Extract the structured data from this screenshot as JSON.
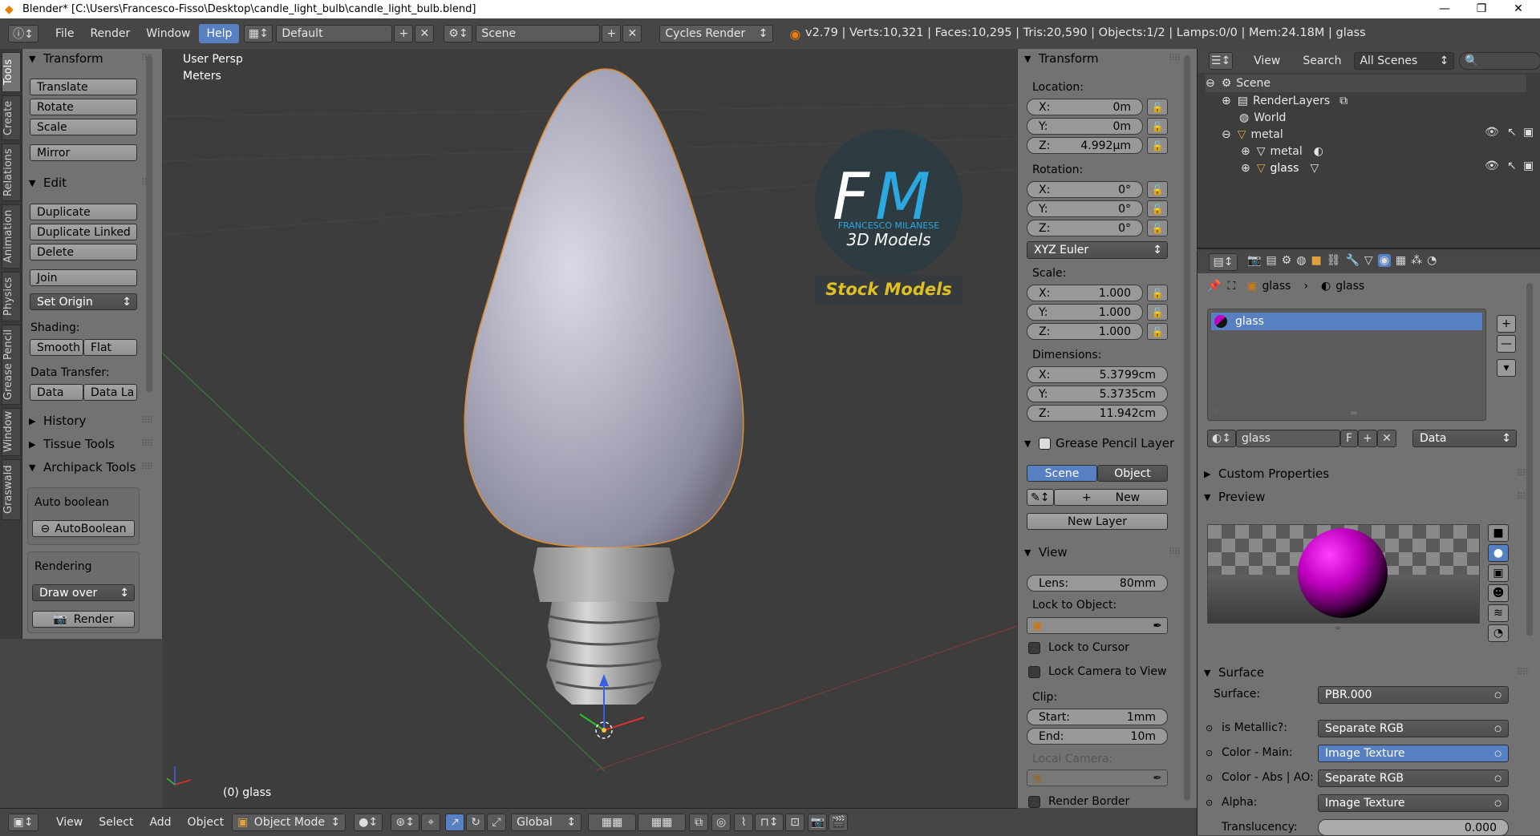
{
  "window": {
    "title": "Blender* [C:\\Users\\Francesco-Fisso\\Desktop\\candle_light_bulb\\candle_light_bulb.blend]"
  },
  "menu": {
    "items": [
      "File",
      "Render",
      "Window",
      "Help"
    ],
    "layout": "Default",
    "scene": "Scene",
    "engine": "Cycles Render"
  },
  "stats": "v2.79 | Verts:10,321 | Faces:10,295 | Tris:20,590 | Objects:1/2 | Lamps:0/0 | Mem:24.18M | glass",
  "tabs": [
    "Tools",
    "Create",
    "Relations",
    "Animation",
    "Physics",
    "Grease Pencil",
    "Window",
    "Graswald"
  ],
  "toolshelf": {
    "transform_title": "Transform",
    "translate": "Translate",
    "rotate": "Rotate",
    "scale": "Scale",
    "mirror": "Mirror",
    "edit_title": "Edit",
    "duplicate": "Duplicate",
    "duplicate_linked": "Duplicate Linked",
    "delete": "Delete",
    "join": "Join",
    "set_origin": "Set Origin",
    "shading_label": "Shading:",
    "smooth": "Smooth",
    "flat": "Flat",
    "data_transfer_label": "Data Transfer:",
    "data": "Data",
    "data_la": "Data La",
    "history": "History",
    "tissue": "Tissue Tools",
    "archipack": "Archipack Tools",
    "auto_boolean_label": "Auto boolean",
    "auto_boolean_btn": "AutoBoolean",
    "rendering_label": "Rendering",
    "draw_over": "Draw over",
    "render": "Render"
  },
  "viewport": {
    "view_name": "User Persp",
    "units": "Meters",
    "object_label": "(0) glass",
    "logo": {
      "letters_f": "F",
      "letters_m": "M",
      "name": "FRANCESCO MILANESE",
      "sub": "3D Models",
      "stock": "Stock Models"
    }
  },
  "npanel": {
    "transform_title": "Transform",
    "location_label": "Location:",
    "loc_x": "0m",
    "loc_y": "0m",
    "loc_z": "4.992µm",
    "rotation_label": "Rotation:",
    "rot_x": "0°",
    "rot_y": "0°",
    "rot_z": "0°",
    "rot_mode": "XYZ Euler",
    "scale_label": "Scale:",
    "scale_x": "1.000",
    "scale_y": "1.000",
    "scale_z": "1.000",
    "dimensions_label": "Dimensions:",
    "dim_x": "5.3799cm",
    "dim_y": "5.3735cm",
    "dim_z": "11.942cm",
    "grease_title": "Grease Pencil Layer",
    "scene_btn": "Scene",
    "object_btn": "Object",
    "new_btn": "New",
    "new_layer": "New Layer",
    "view_title": "View",
    "lens_label": "Lens:",
    "lens_value": "80mm",
    "lock_object_label": "Lock to Object:",
    "lock_cursor": "Lock to Cursor",
    "lock_camera": "Lock Camera to View",
    "clip_label": "Clip:",
    "clip_start_label": "Start:",
    "clip_start": "1mm",
    "clip_end_label": "End:",
    "clip_end": "10m",
    "local_camera": "Local Camera:",
    "render_border": "Render Border"
  },
  "axis_labels": {
    "x": "X:",
    "y": "Y:",
    "z": "Z:"
  },
  "outliner": {
    "view": "View",
    "search": "Search",
    "filter": "All Scenes",
    "rows": [
      {
        "label": "Scene"
      },
      {
        "label": "RenderLayers"
      },
      {
        "label": "World"
      },
      {
        "label": "metal"
      },
      {
        "label": "metal"
      },
      {
        "label": "glass"
      }
    ]
  },
  "properties": {
    "crumb_1": "glass",
    "crumb_2": "glass",
    "slot": "glass",
    "material_name": "glass",
    "f_label": "F",
    "data_dropdown": "Data",
    "custom_props": "Custom Properties",
    "preview": "Preview",
    "surface_title": "Surface",
    "surface_label": "Surface:",
    "surface_value": "PBR.000",
    "metallic_label": "is Metallic?:",
    "metallic_value": "Separate RGB",
    "color_main_label": "Color - Main:",
    "color_main_value": "Image Texture",
    "color_abs_label": "Color - Abs | AO:",
    "color_abs_value": "Separate RGB",
    "alpha_label": "Alpha:",
    "alpha_value": "Image Texture",
    "translucency_label": "Translucency:",
    "translucency_value": "0.000"
  },
  "bottombar": {
    "view": "View",
    "select": "Select",
    "add": "Add",
    "object": "Object",
    "mode": "Object Mode",
    "orientation": "Global"
  },
  "colors": {
    "accent": "#5680c2",
    "orange": "#e87d0d",
    "panel": "#727272",
    "viewport": "#3d3d3d",
    "magenta": "#c000c0"
  }
}
